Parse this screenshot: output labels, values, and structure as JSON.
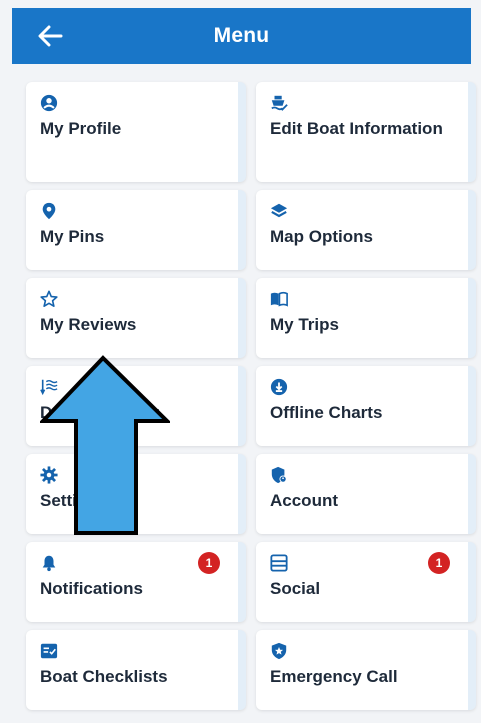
{
  "header": {
    "title": "Menu"
  },
  "colors": {
    "accent": "#1976c8",
    "icon": "#1563ad",
    "badge": "#d32323",
    "arrow": "#43a5e4"
  },
  "menu": [
    {
      "label": "My Profile",
      "icon": "user-circle-icon"
    },
    {
      "label": "Edit Boat Information",
      "icon": "boat-edit-icon"
    },
    {
      "label": "My Pins",
      "icon": "map-pin-icon"
    },
    {
      "label": "Map Options",
      "icon": "layers-icon"
    },
    {
      "label": "My Reviews",
      "icon": "star-icon"
    },
    {
      "label": "My Trips",
      "icon": "book-open-icon"
    },
    {
      "label": "Depth Shading",
      "icon": "depth-waves-icon"
    },
    {
      "label": "Offline Charts",
      "icon": "download-circle-icon"
    },
    {
      "label": "Settings",
      "icon": "gear-icon"
    },
    {
      "label": "Account",
      "icon": "shield-user-icon"
    },
    {
      "label": "Notifications",
      "icon": "bell-icon",
      "badge": "1"
    },
    {
      "label": "Social",
      "icon": "list-panel-icon",
      "badge": "1"
    },
    {
      "label": "Boat Checklists",
      "icon": "checklist-icon"
    },
    {
      "label": "Emergency Call",
      "icon": "shield-star-icon"
    }
  ]
}
